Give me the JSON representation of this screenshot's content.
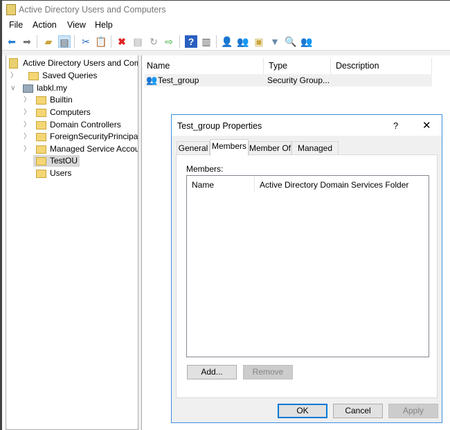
{
  "window": {
    "title": "Active Directory Users and Computers"
  },
  "menu": [
    "File",
    "Action",
    "View",
    "Help"
  ],
  "toolbar": [
    "back-icon",
    "forward-icon",
    "up-folder-icon",
    "show-console-tree-icon",
    "cut-icon",
    "paste-icon",
    "delete-icon",
    "properties-icon",
    "refresh-icon",
    "export-icon",
    "help-icon",
    "action-pane-icon",
    "new-user-icon",
    "new-group-icon",
    "new-ou-icon",
    "filter-icon",
    "find-icon",
    "add-to-group-icon"
  ],
  "tree": {
    "root": "Active Directory Users and Com",
    "items": [
      {
        "label": "Saved Queries",
        "level": 1,
        "expander": "collapsed"
      },
      {
        "label": "labkl.my",
        "level": 1,
        "expander": "expanded"
      },
      {
        "label": "Builtin",
        "level": 2,
        "expander": "collapsed"
      },
      {
        "label": "Computers",
        "level": 2,
        "expander": "collapsed"
      },
      {
        "label": "Domain Controllers",
        "level": 2,
        "expander": "collapsed"
      },
      {
        "label": "ForeignSecurityPrincipals",
        "level": 2,
        "expander": "collapsed"
      },
      {
        "label": "Managed Service Accounts",
        "level": 2,
        "expander": "collapsed"
      },
      {
        "label": "TestOU",
        "level": 2,
        "expander": "none",
        "selected": true
      },
      {
        "label": "Users",
        "level": 2,
        "expander": "none"
      }
    ]
  },
  "list": {
    "columns": [
      "Name",
      "Type",
      "Description"
    ],
    "rows": [
      {
        "name": "Test_group",
        "type": "Security Group...",
        "description": ""
      }
    ]
  },
  "dialog": {
    "title": "Test_group Properties",
    "help": "?",
    "close": "✕",
    "tabs": [
      "General",
      "Members",
      "Member Of",
      "Managed By"
    ],
    "active_tab": "Members",
    "members_label": "Members:",
    "columns": [
      "Name",
      "Active Directory Domain Services Folder"
    ],
    "add": "Add...",
    "remove": "Remove",
    "ok": "OK",
    "cancel": "Cancel",
    "apply": "Apply"
  }
}
